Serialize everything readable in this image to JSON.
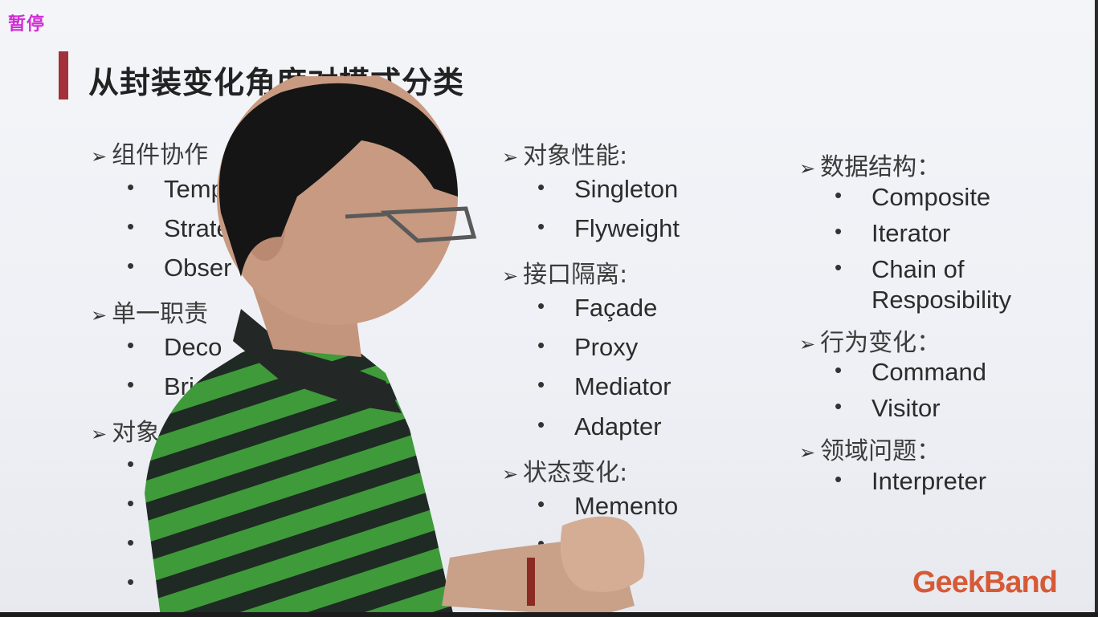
{
  "pause_label": "暂停",
  "slide": {
    "title": "从封装变化角度对模式分类",
    "col1": {
      "cat1": "组件协作",
      "items1": [
        "Temp",
        "Strate",
        "Obser"
      ],
      "cat2": "单一职责",
      "items2": [
        "Deco",
        "Bri"
      ],
      "cat3": "对象"
    },
    "col2": {
      "cat1": "对象性能:",
      "items1": [
        "Singleton",
        "Flyweight"
      ],
      "cat2": "接口隔离:",
      "items2": [
        "Façade",
        "Proxy",
        "Mediator",
        "Adapter"
      ],
      "cat3": "状态变化:",
      "items3": [
        "Memento"
      ]
    },
    "col3": {
      "cat1": "数据结构：",
      "items1": [
        "Composite",
        "Iterator",
        "Chain of",
        "Resposibility"
      ],
      "cat2": "行为变化：",
      "items2": [
        "Command",
        "Visitor"
      ],
      "cat3": "领域问题：",
      "items3": [
        "Interpreter"
      ]
    }
  },
  "logo": "GeekBand",
  "colors": {
    "title_accent": "#a3303a",
    "pause": "#d12bd6",
    "logo": "#d65a36",
    "shirt_green": "#3f9a3a",
    "shirt_dark": "#1f2a24"
  }
}
